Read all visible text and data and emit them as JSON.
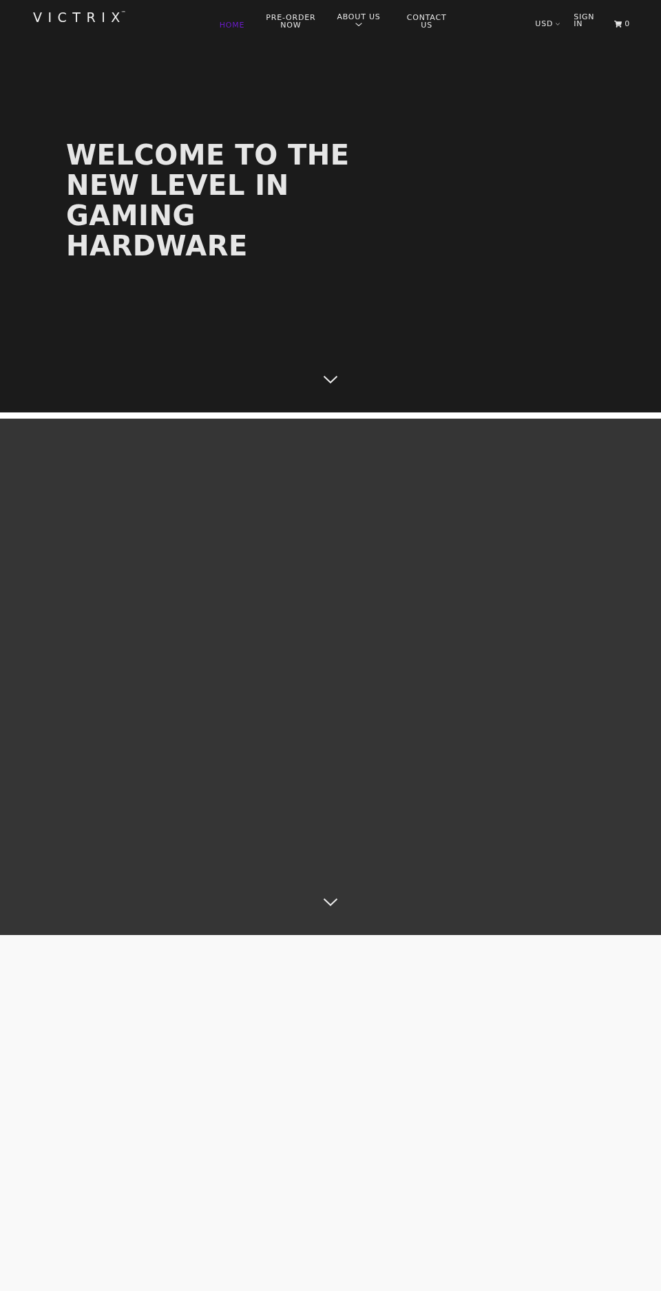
{
  "header": {
    "logo": "VICTRIX$^{™}$",
    "nav": [
      {
        "label": "HOME",
        "selected": true,
        "kind": "link"
      },
      {
        "label": "PRE-ORDER NOW",
        "selected": false,
        "kind": "link"
      },
      {
        "label": "ABOUT US",
        "selected": false,
        "kind": "dropdown"
      },
      {
        "label": "CONTACT US",
        "selected": false,
        "kind": "link"
      }
    ],
    "currency": "USD",
    "sign_in": "SIGN IN",
    "cart_count": "0"
  },
  "hero": {
    "title": "WELCOME TO THE NEW LEVEL IN GAMING HARDWARE"
  }
}
